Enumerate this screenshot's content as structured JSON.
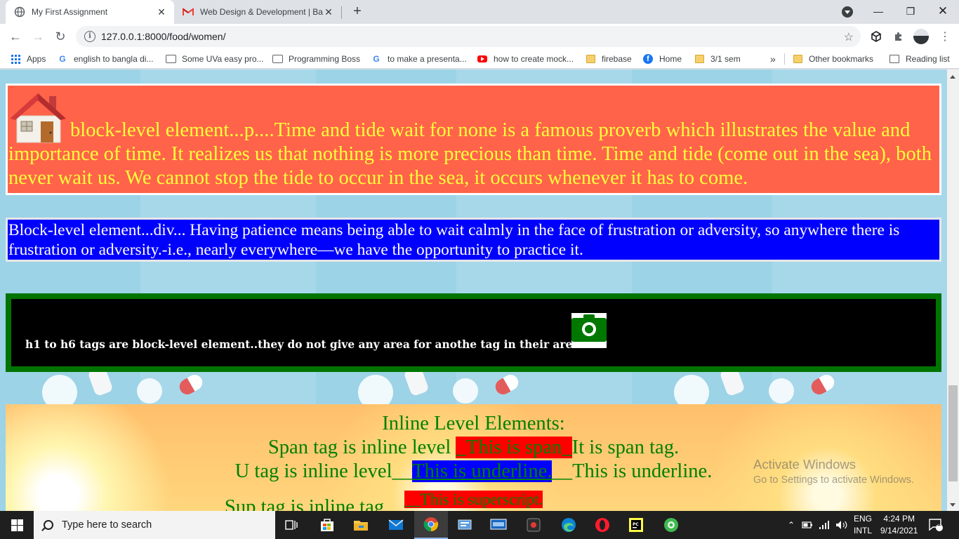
{
  "browser": {
    "tabs": [
      {
        "title": "My First Assignment",
        "icon": "globe-icon"
      },
      {
        "title": "Web Design & Development | Ba",
        "icon": "gmail-icon"
      }
    ],
    "url": "127.0.0.1:8000/food/women/",
    "bookmarks": [
      {
        "label": "Apps",
        "icon": "apps-grid-icon"
      },
      {
        "label": "english to bangla di...",
        "icon": "google-icon"
      },
      {
        "label": "Some UVa easy pro...",
        "icon": "page-icon"
      },
      {
        "label": "Programming Boss",
        "icon": "page-icon"
      },
      {
        "label": "to make a presenta...",
        "icon": "google-icon"
      },
      {
        "label": "how to create mock...",
        "icon": "youtube-icon"
      },
      {
        "label": "firebase",
        "icon": "folder-icon"
      },
      {
        "label": "Home",
        "icon": "facebook-icon"
      },
      {
        "label": "3/1 sem",
        "icon": "folder-icon"
      },
      {
        "label": "»",
        "icon": "chevron-icon"
      },
      {
        "label": "Other bookmarks",
        "icon": "folder-icon"
      },
      {
        "label": "Reading list",
        "icon": "reading-list-icon"
      }
    ]
  },
  "page": {
    "block_p": {
      "icon": "house-icon",
      "text": "block-level element...p....Time and tide wait for none is a famous proverb which illustrates the value and importance of time. It realizes us that nothing is more precious than time. Time and tide (come out in the sea), both never wait us. We cannot stop the tide to occur in the sea, it occurs whenever it has to come."
    },
    "block_div": {
      "text": "Block-level element...div... Having patience means being able to wait calmly in the face of frustration or adversity, so anywhere there is frustration or adversity.-i.e., nearly everywhere—we have the opportunity to practice it."
    },
    "block_h": {
      "text": "h1 to h6 tags are block-level element..they do not give any area for anothe tag in their area.",
      "icon": "camera-icon"
    },
    "inline": {
      "heading": "Inline Level Elements:",
      "span_line": {
        "before": "Span tag is inline level ",
        "highlight": "_This is span_",
        "after": "It is span tag."
      },
      "u_line": {
        "before": "U tag is inline level__",
        "highlight": "This is underline.",
        "after": "__This is underline."
      },
      "sup_line": {
        "before": "Sup tag is inline tag__",
        "highlight": "__This is superscript."
      }
    },
    "watermark": {
      "title": "Activate Windows",
      "subtitle": "Go to Settings to activate Windows."
    }
  },
  "taskbar": {
    "search_placeholder": "Type here to search",
    "language": "ENG",
    "layout": "INTL",
    "time": "4:24 PM",
    "date": "9/14/2021",
    "notification_count": "1"
  },
  "colors": {
    "block_p_bg": "#ff634a",
    "block_p_text": "#ffff3a",
    "block_div_bg": "#0000ff",
    "block_h_bg": "#000000",
    "block_h_border": "#007400",
    "inline_text": "#008000"
  }
}
